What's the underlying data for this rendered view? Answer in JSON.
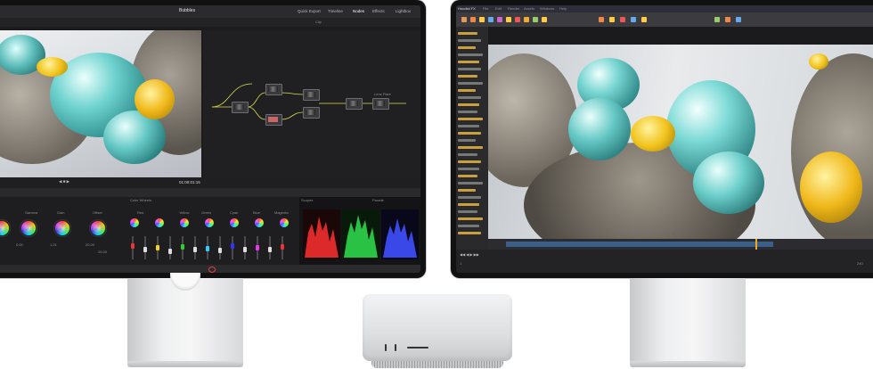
{
  "scene": {
    "subject": "",
    "background_color": "#ffffff"
  },
  "left_display": {
    "app": {
      "page_title": "Bubbles",
      "timecode": "01:00:01:15",
      "tabs": [
        "Quick Export",
        "Timeline",
        "Nodes",
        "Effects",
        "Lightbox"
      ],
      "clip_label": "Clip",
      "color_panel_title": "Color Wheels",
      "scopes_label": "Scopes",
      "scopes_mode": "Parade",
      "wheels": [
        "Lift",
        "Gamma",
        "Gain",
        "Offset"
      ],
      "wheel_values": [
        "0.00",
        "1.21",
        "20.00",
        "25.00"
      ],
      "curve_channels": [
        "Red",
        "Yellow",
        "Green",
        "Cyan",
        "Blue",
        "Magenta"
      ],
      "zero_value": "0.00",
      "node_label": "Lens Flare"
    }
  },
  "right_display": {
    "app": {
      "title": "Houdini FX",
      "menu": [
        "File",
        "Edit",
        "Render",
        "Assets",
        "Windows",
        "Help"
      ],
      "viewport_caption": "...",
      "timeline_start": "1",
      "timeline_end": "240"
    }
  },
  "colors": {
    "teal_blob": "#57c7c4",
    "yellow_blob": "#f2c51e",
    "rock": "#8a8479",
    "scope_red": "#ff3030",
    "scope_green": "#30e050",
    "scope_blue": "#4050ff",
    "aluminum": "#e3e4e6"
  }
}
